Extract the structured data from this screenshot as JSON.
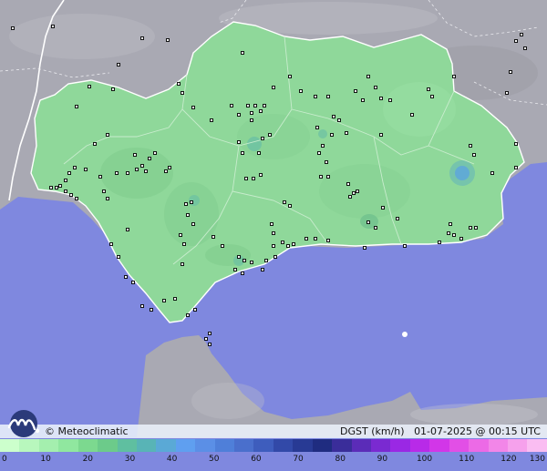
{
  "map": {
    "region": "Andalusia",
    "colors": {
      "sea": "#7f88df",
      "land_outside": "#a9a9b3",
      "region_fill": "#8fd89a",
      "region_fill_dark": "#7ccb8a",
      "borders": "#ffffff",
      "station_marker": "#000000"
    }
  },
  "footer": {
    "brand": "© Meteoclimatic",
    "variable": "DGST (km/h)",
    "timestamp": "01-07-2025 @ 00:15 UTC"
  },
  "scale": {
    "unit": "km/h",
    "labels": [
      "0",
      "10",
      "20",
      "30",
      "40",
      "50",
      "60",
      "70",
      "80",
      "90",
      "100",
      "110",
      "120",
      "130"
    ],
    "colors": [
      "#ccffcc",
      "#b8f7bd",
      "#a4efae",
      "#90e79f",
      "#7cd98f",
      "#6ccb8a",
      "#5fbfa0",
      "#58b4b6",
      "#5aa9d6",
      "#5f9ff0",
      "#5b8fe6",
      "#4f7fd9",
      "#4a6fcc",
      "#3e5dbd",
      "#3249a8",
      "#283a94",
      "#1f2c80",
      "#3a2d9a",
      "#5b2cb8",
      "#7a2ad1",
      "#9a28e4",
      "#b82ae8",
      "#d236e8",
      "#e24fe6",
      "#ec6ae6",
      "#f286e8",
      "#f6a1ec",
      "#fabdf2"
    ]
  }
}
